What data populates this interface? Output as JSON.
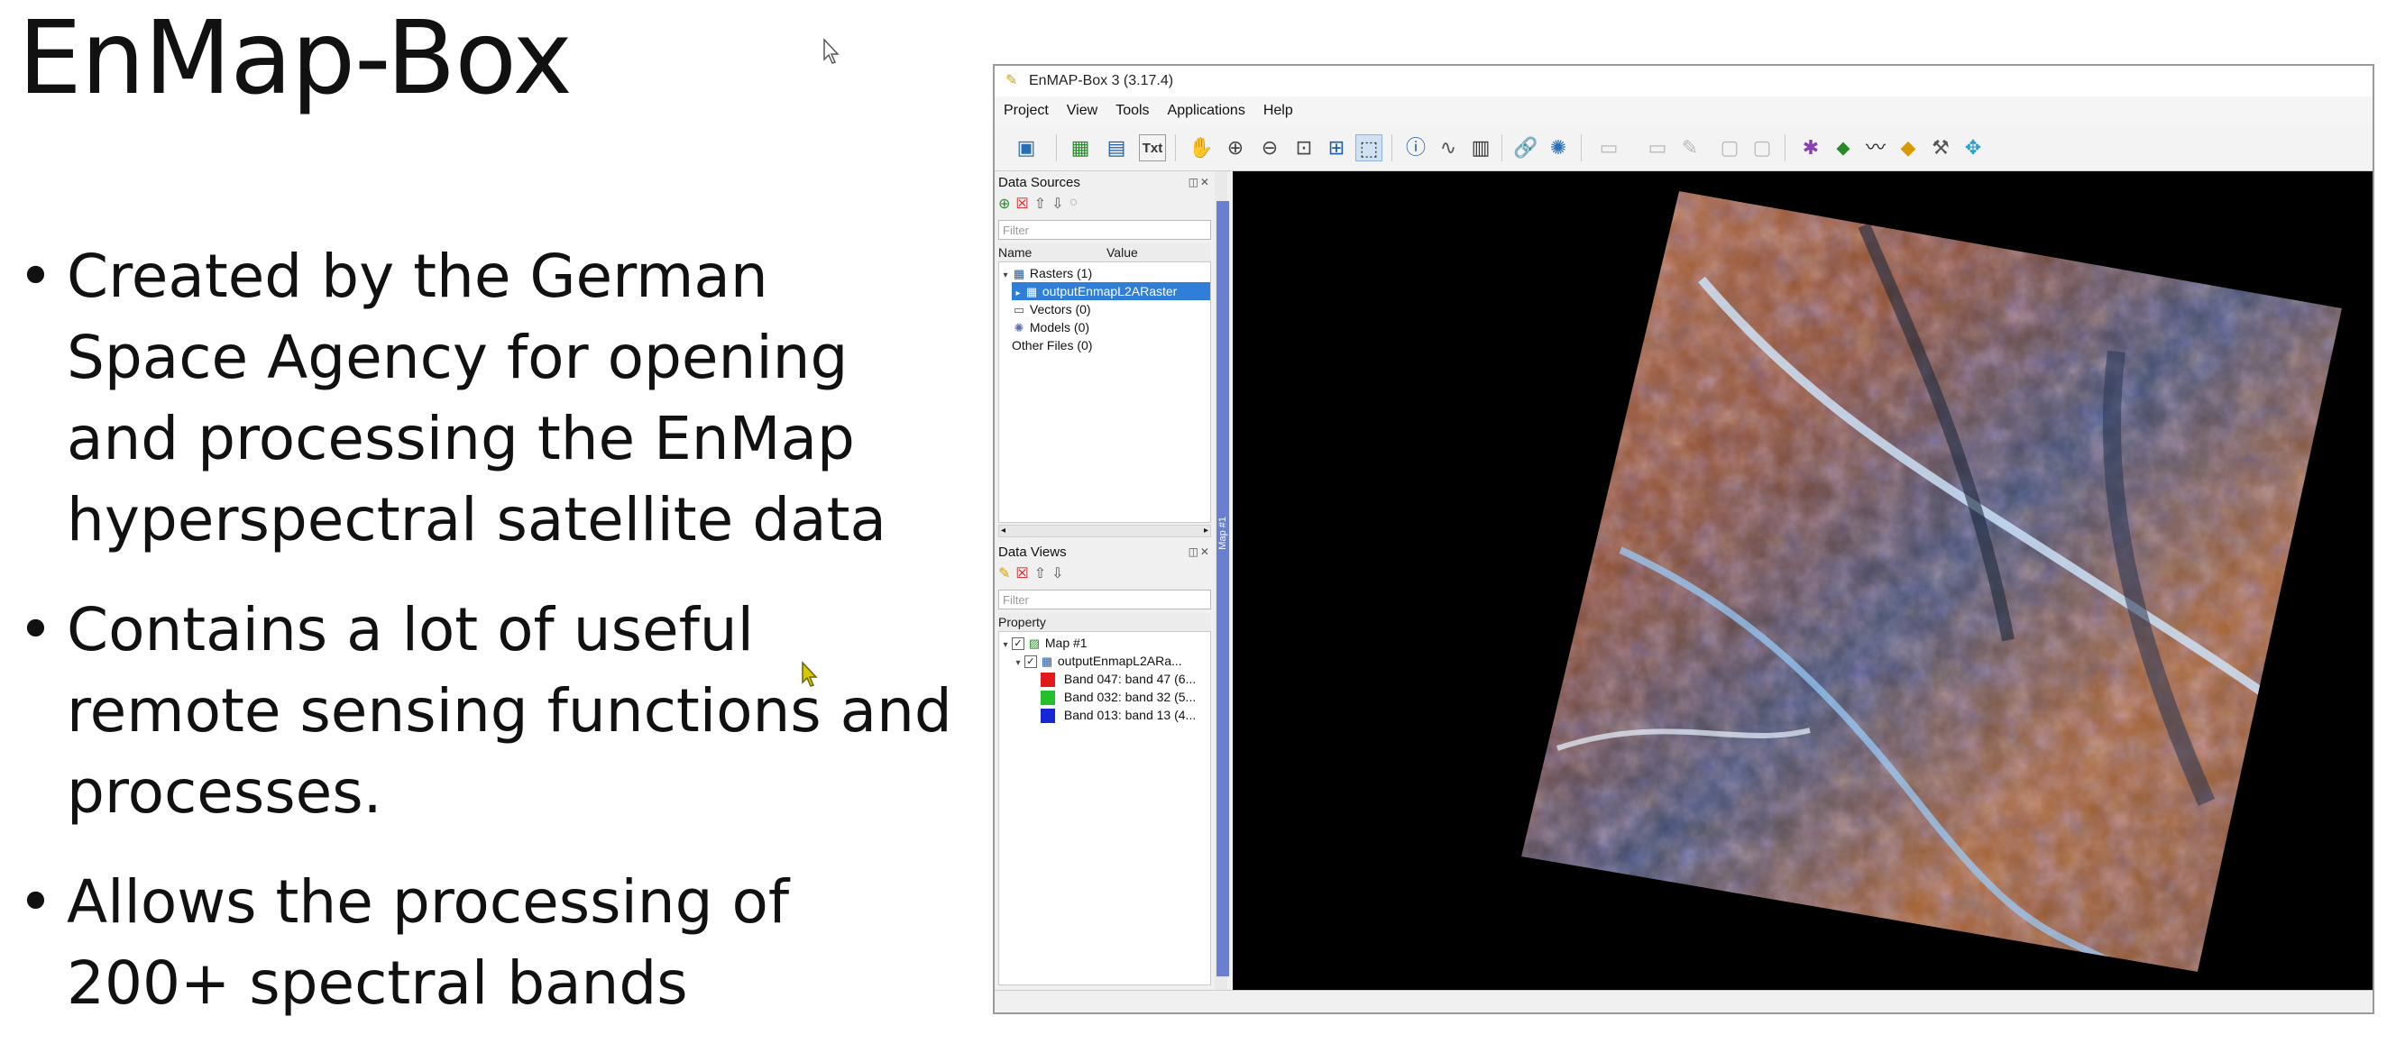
{
  "slide": {
    "title": "EnMap-Box",
    "bullets": [
      "Created by the German Space Agency for opening and processing the EnMap hyperspectral satellite data",
      "Contains a lot of useful remote sensing functions and processes.",
      "Allows the processing of 200+ spectral bands"
    ]
  },
  "window": {
    "title": "EnMAP-Box 3 (3.17.4)",
    "menu": [
      "Project",
      "View",
      "Tools",
      "Applications",
      "Help"
    ]
  },
  "data_sources": {
    "title": "Data Sources",
    "filter_placeholder": "Filter",
    "columns": [
      "Name",
      "Value"
    ],
    "rows": [
      {
        "label": "Rasters (1)"
      },
      {
        "label": "outputEnmapL2ARaster"
      },
      {
        "label": "Vectors (0)"
      },
      {
        "label": "Models (0)"
      },
      {
        "label": "Other Files (0)"
      }
    ]
  },
  "data_views": {
    "title": "Data Views",
    "filter_placeholder": "Filter",
    "column": "Property",
    "rows": [
      {
        "label": "Map #1"
      },
      {
        "label": "outputEnmapL2ARa..."
      },
      {
        "label": "Band 047: band 47 (6...",
        "color": "#e31a1c"
      },
      {
        "label": "Band 032: band 32 (5...",
        "color": "#22c02a"
      },
      {
        "label": "Band 013: band 13 (4...",
        "color": "#1428d6"
      }
    ]
  },
  "map": {
    "tab_label": "Map #1"
  },
  "colors": {
    "selection": "#2f7ed8",
    "map_background": "#000000",
    "map_tab": "#6a7fd0"
  },
  "icons": [
    "open-project-icon",
    "add-raster-icon",
    "add-layer-icon",
    "text-icon",
    "pan-icon",
    "zoom-in-icon",
    "zoom-out-icon",
    "zoom-full-icon",
    "zoom-pixel-icon",
    "select-icon",
    "identify-info-icon",
    "profile-icon",
    "spectral-library-icon",
    "link-icon",
    "settings-gear-icon",
    "edit-icon",
    "save-icon",
    "processing-icon",
    "location-pin-icon",
    "spectral-profile-icon",
    "layers-icon",
    "tools-icon",
    "crosshair-icon"
  ]
}
